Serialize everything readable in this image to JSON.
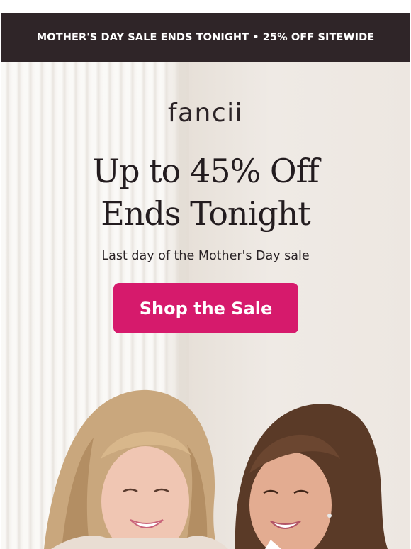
{
  "promo_bar": {
    "text": "MOTHER'S DAY SALE ENDS TONIGHT • 25% OFF SITEWIDE"
  },
  "hero": {
    "logo": "fancii",
    "headline_line1": "Up to 45% Off",
    "headline_line2": "Ends Tonight",
    "subline": "Last day of the Mother's Day sale",
    "cta_label": "Shop the Sale"
  },
  "colors": {
    "promo_bar_bg": "#2f2528",
    "cta_bg": "#d61a6c",
    "text_dark": "#231c1f"
  }
}
